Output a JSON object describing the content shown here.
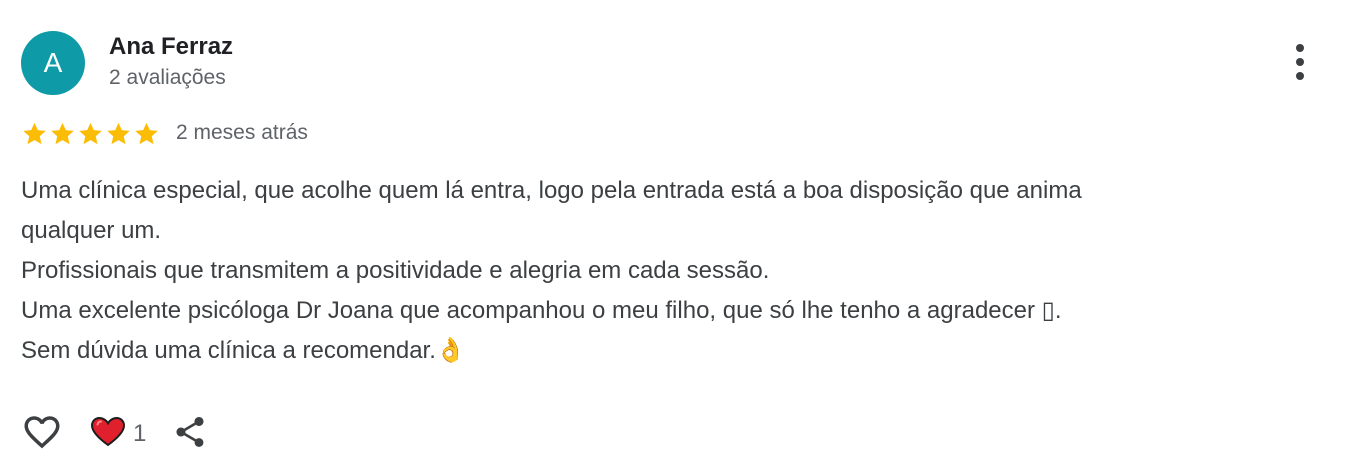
{
  "reviewer": {
    "avatar_letter": "A",
    "avatar_color": "#0e9aa7",
    "name": "Ana Ferraz",
    "meta": "2 avaliações"
  },
  "menu": {
    "icon": "more-vert-icon"
  },
  "rating": {
    "stars": 5,
    "max_stars": 5,
    "star_color": "#fbbc04",
    "date": "2 meses atrás"
  },
  "review": {
    "lines": [
      "Uma clínica especial, que acolhe quem lá entra, logo pela entrada está a boa disposição que anima",
      "qualquer um.",
      "Profissionais que transmitem a positividade e alegria em cada sessão.",
      "Uma excelente psicóloga Dr Joana que acompanhou o meu filho, que só lhe tenho a agradecer ▯.",
      "Sem dúvida uma clínica a recomendar.👌"
    ]
  },
  "actions": {
    "like_icon": "heart-outline-icon",
    "reaction_icon": "red-heart-icon",
    "reaction_count": "1",
    "share_icon": "share-icon"
  }
}
